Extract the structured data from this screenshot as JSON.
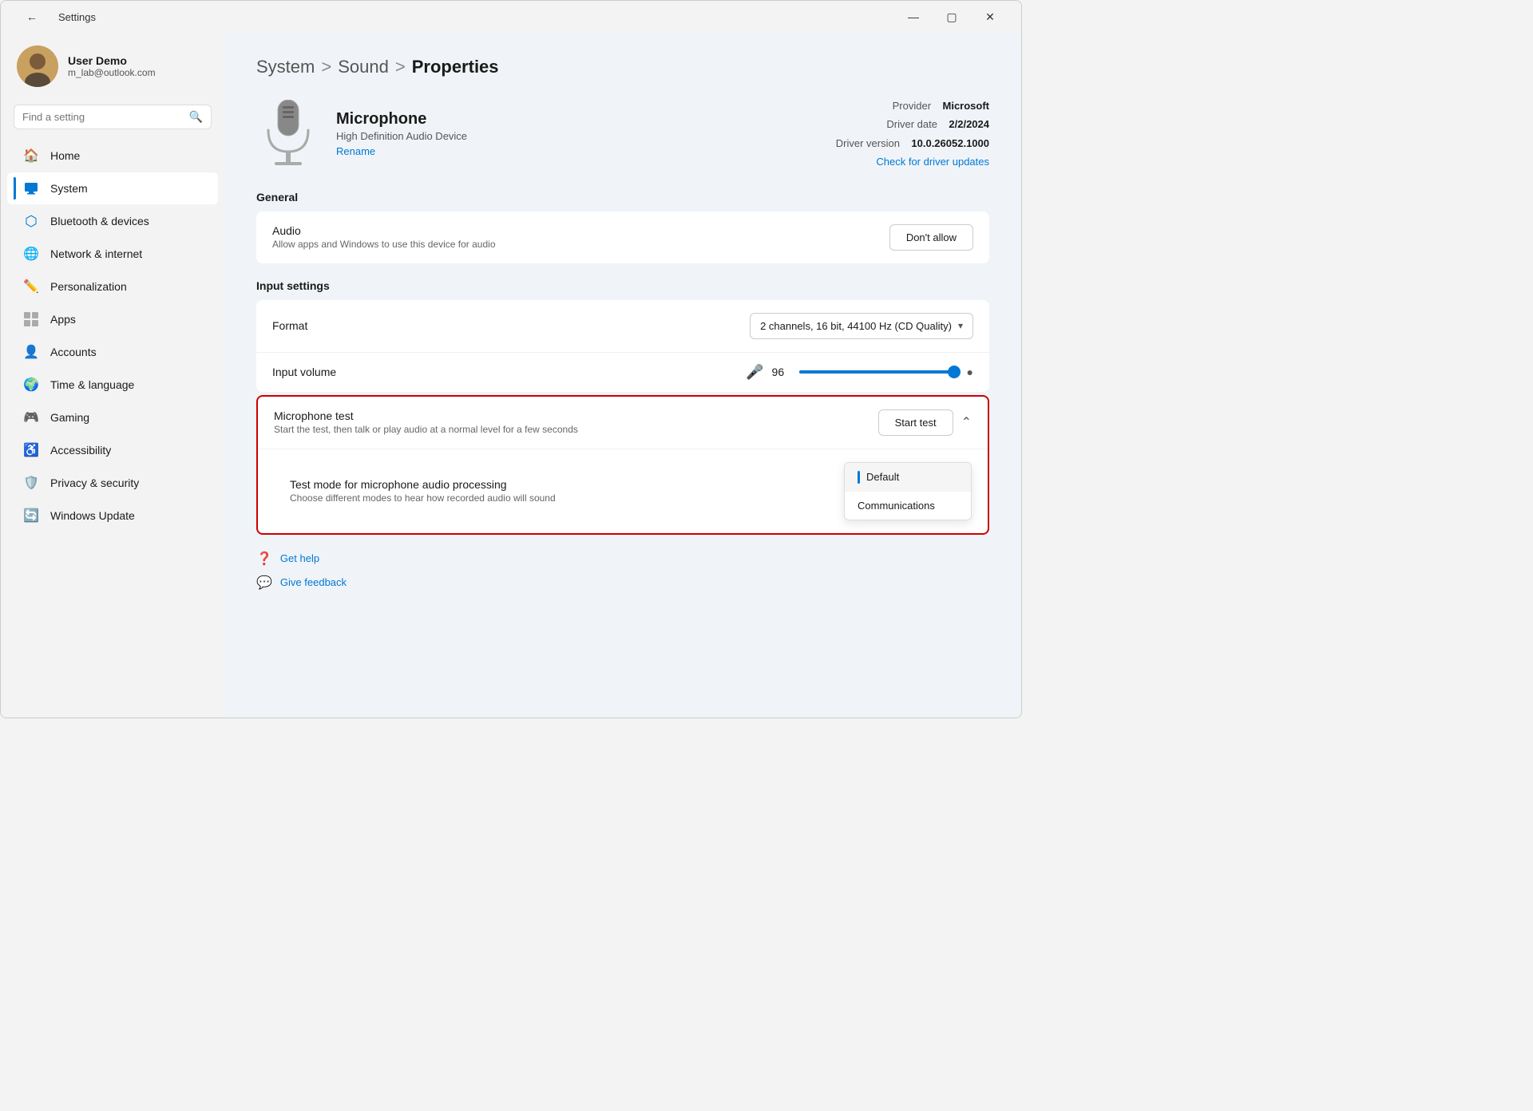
{
  "window": {
    "title": "Settings",
    "min_label": "—",
    "max_label": "▢",
    "close_label": "✕"
  },
  "sidebar": {
    "search_placeholder": "Find a setting",
    "user": {
      "name": "User Demo",
      "email": "m_lab@outlook.com"
    },
    "nav_items": [
      {
        "id": "home",
        "label": "Home",
        "icon": "🏠"
      },
      {
        "id": "system",
        "label": "System",
        "icon": "💻",
        "active": true
      },
      {
        "id": "bluetooth",
        "label": "Bluetooth & devices",
        "icon": "🔵"
      },
      {
        "id": "network",
        "label": "Network & internet",
        "icon": "🌐"
      },
      {
        "id": "personalization",
        "label": "Personalization",
        "icon": "✏️"
      },
      {
        "id": "apps",
        "label": "Apps",
        "icon": "📦"
      },
      {
        "id": "accounts",
        "label": "Accounts",
        "icon": "👤"
      },
      {
        "id": "time",
        "label": "Time & language",
        "icon": "🌍"
      },
      {
        "id": "gaming",
        "label": "Gaming",
        "icon": "🎮"
      },
      {
        "id": "accessibility",
        "label": "Accessibility",
        "icon": "♿"
      },
      {
        "id": "privacy",
        "label": "Privacy & security",
        "icon": "🛡️"
      },
      {
        "id": "windows-update",
        "label": "Windows Update",
        "icon": "🔄"
      }
    ]
  },
  "main": {
    "breadcrumb": {
      "part1": "System",
      "sep1": ">",
      "part2": "Sound",
      "sep2": ">",
      "part3": "Properties"
    },
    "device": {
      "name": "Microphone",
      "subtitle": "High Definition Audio Device",
      "rename_label": "Rename",
      "provider_label": "Provider",
      "provider_value": "Microsoft",
      "driver_date_label": "Driver date",
      "driver_date_value": "2/2/2024",
      "driver_version_label": "Driver version",
      "driver_version_value": "10.0.26052.1000",
      "driver_update_label": "Check for driver updates"
    },
    "general_section": {
      "header": "General",
      "audio_title": "Audio",
      "audio_subtitle": "Allow apps and Windows to use this device for audio",
      "audio_btn_label": "Don't allow"
    },
    "input_settings_section": {
      "header": "Input settings",
      "format_label": "Format",
      "format_value": "2 channels, 16 bit, 44100 Hz (CD Quality)",
      "volume_label": "Input volume",
      "volume_value": "96"
    },
    "mic_test_section": {
      "title": "Microphone test",
      "subtitle": "Start the test, then talk or play audio at a normal level for a few seconds",
      "start_btn_label": "Start test",
      "test_mode_title": "Test mode for microphone audio processing",
      "test_mode_subtitle": "Choose different modes to hear how recorded audio will sound",
      "dropdown_options": [
        {
          "label": "Default",
          "selected": true
        },
        {
          "label": "Communications",
          "selected": false
        }
      ]
    },
    "bottom_links": [
      {
        "label": "Get help",
        "icon": "❓"
      },
      {
        "label": "Give feedback",
        "icon": "💬"
      }
    ]
  }
}
